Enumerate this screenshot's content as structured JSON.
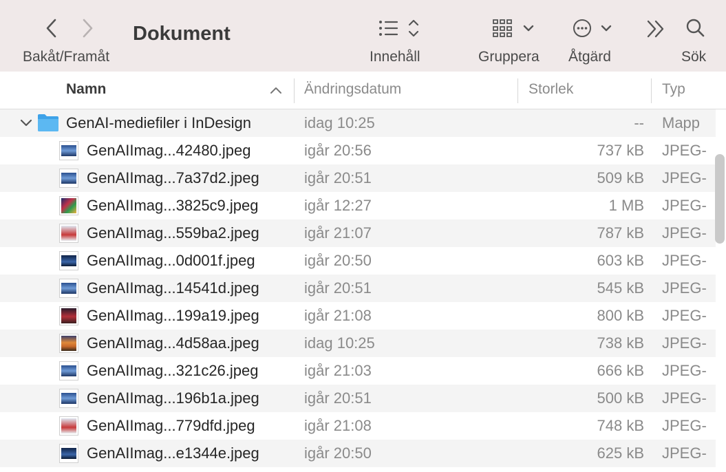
{
  "toolbar": {
    "back_forward_label": "Bakåt/Framåt",
    "title": "Dokument",
    "view_label": "Innehåll",
    "group_label": "Gruppera",
    "action_label": "Åtgärd",
    "search_label": "Sök"
  },
  "columns": {
    "name": "Namn",
    "date": "Ändringsdatum",
    "size": "Storlek",
    "type": "Typ"
  },
  "folder": {
    "name": "GenAI-mediefiler i InDesign",
    "date": "idag 10:25",
    "size": "--",
    "type": "Mapp"
  },
  "files": [
    {
      "name": "GenAIImag...42480.jpeg",
      "date": "igår 20:56",
      "size": "737 kB",
      "type": "JPEG-",
      "thumb": "blue"
    },
    {
      "name": "GenAIImag...7a37d2.jpeg",
      "date": "igår 20:51",
      "size": "509 kB",
      "type": "JPEG-",
      "thumb": "blue"
    },
    {
      "name": "GenAIImag...3825c9.jpeg",
      "date": "igår 12:27",
      "size": "1 MB",
      "type": "JPEG-",
      "thumb": "colorful"
    },
    {
      "name": "GenAIImag...559ba2.jpeg",
      "date": "igår 21:07",
      "size": "787 kB",
      "type": "JPEG-",
      "thumb": "red-white"
    },
    {
      "name": "GenAIImag...0d001f.jpeg",
      "date": "igår 20:50",
      "size": "603 kB",
      "type": "JPEG-",
      "thumb": "night"
    },
    {
      "name": "GenAIImag...14541d.jpeg",
      "date": "igår 20:51",
      "size": "545 kB",
      "type": "JPEG-",
      "thumb": "blue"
    },
    {
      "name": "GenAIImag...199a19.jpeg",
      "date": "igår 21:08",
      "size": "800 kB",
      "type": "JPEG-",
      "thumb": "red-dark"
    },
    {
      "name": "GenAIImag...4d58aa.jpeg",
      "date": "idag 10:25",
      "size": "738 kB",
      "type": "JPEG-",
      "thumb": "sunset"
    },
    {
      "name": "GenAIImag...321c26.jpeg",
      "date": "igår 21:03",
      "size": "666 kB",
      "type": "JPEG-",
      "thumb": "blue"
    },
    {
      "name": "GenAIImag...196b1a.jpeg",
      "date": "igår 20:51",
      "size": "500 kB",
      "type": "JPEG-",
      "thumb": "blue"
    },
    {
      "name": "GenAIImag...779dfd.jpeg",
      "date": "igår 21:08",
      "size": "748 kB",
      "type": "JPEG-",
      "thumb": "red-white"
    },
    {
      "name": "GenAIImag...e1344e.jpeg",
      "date": "igår 20:50",
      "size": "625 kB",
      "type": "JPEG-",
      "thumb": "night"
    }
  ],
  "thumb_styles": {
    "blue": "linear-gradient(180deg,#2a4f8f 0%,#6f9bd6 50%,#1e3766 100%)",
    "colorful": "linear-gradient(135deg,#1b2a6b 0%,#c2314a 40%,#2d9c4f 65%,#f0b040 100%)",
    "red-white": "linear-gradient(180deg,#dfe8f2 0%,#c73a3a 60%,#e8ecf0 100%)",
    "night": "linear-gradient(180deg,#0f2347 0%,#3b66a8 60%,#0b1a33 100%)",
    "red-dark": "linear-gradient(180deg,#2a1a2a 0%,#b3303a 55%,#3b1f1f 100%)",
    "sunset": "linear-gradient(180deg,#3b3f6b 0%,#e08a3a 45%,#c9692a 70%,#3a2a1a 100%)"
  },
  "colors": {
    "toolbar_bg": "#f0e9e9",
    "folder_blue": "#3aa3ec",
    "row_stripe": "#f4f4f4"
  },
  "icons": [
    "chevron-left-icon",
    "chevron-right-icon",
    "list-view-icon",
    "group-grid-icon",
    "action-ellipsis-icon",
    "more-toolbar-icon",
    "search-icon",
    "disclosure-chevron-icon",
    "folder-icon",
    "sort-ascending-icon"
  ]
}
